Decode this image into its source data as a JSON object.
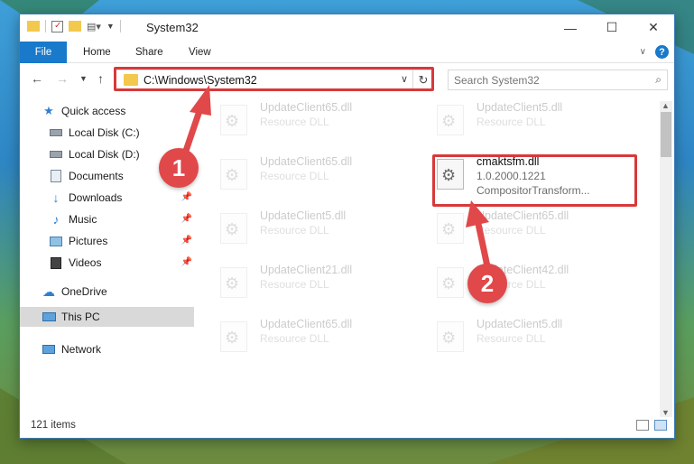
{
  "window": {
    "title": "System32"
  },
  "ribbon": {
    "tabs": [
      {
        "label": "File"
      },
      {
        "label": "Home"
      },
      {
        "label": "Share"
      },
      {
        "label": "View"
      }
    ]
  },
  "address": {
    "path": "C:\\Windows\\System32"
  },
  "search": {
    "placeholder": "Search System32"
  },
  "sidebar": {
    "items": [
      {
        "label": "Quick access",
        "icon": "star-icon"
      },
      {
        "label": "Local Disk (C:)",
        "icon": "drive-icon"
      },
      {
        "label": "Local Disk (D:)",
        "icon": "drive-icon"
      },
      {
        "label": "Documents",
        "icon": "documents-icon"
      },
      {
        "label": "Downloads",
        "icon": "download-icon"
      },
      {
        "label": "Music",
        "icon": "music-icon"
      },
      {
        "label": "Pictures",
        "icon": "pictures-icon"
      },
      {
        "label": "Videos",
        "icon": "videos-icon"
      },
      {
        "label": "OneDrive",
        "icon": "cloud-icon"
      },
      {
        "label": "This PC",
        "icon": "computer-icon"
      },
      {
        "label": "Network",
        "icon": "network-icon"
      }
    ]
  },
  "files": [
    {
      "name": "UpdateClient65.dll",
      "desc": "Resource DLL"
    },
    {
      "name": "UpdateClient5.dll",
      "desc": "Resource DLL"
    },
    {
      "name": "UpdateClient65.dll",
      "desc": "Resource DLL"
    },
    {
      "name": "cmaktsfm.dll",
      "desc": "1.0.2000.1221",
      "desc2": "CompositorTransform..."
    },
    {
      "name": "UpdateClient5.dll",
      "desc": "Resource DLL"
    },
    {
      "name": "UpdateClient65.dll",
      "desc": "Resource DLL"
    },
    {
      "name": "UpdateClient21.dll",
      "desc": "Resource DLL"
    },
    {
      "name": "UpdateClient42.dll",
      "desc": "Resource DLL"
    },
    {
      "name": "UpdateClient65.dll",
      "desc": "Resource DLL"
    },
    {
      "name": "UpdateClient5.dll",
      "desc": "Resource DLL"
    }
  ],
  "status": {
    "item_count": "121 items"
  },
  "annotations": [
    {
      "label": "1",
      "color": "#e0484a"
    },
    {
      "label": "2",
      "color": "#e0484a"
    }
  ]
}
